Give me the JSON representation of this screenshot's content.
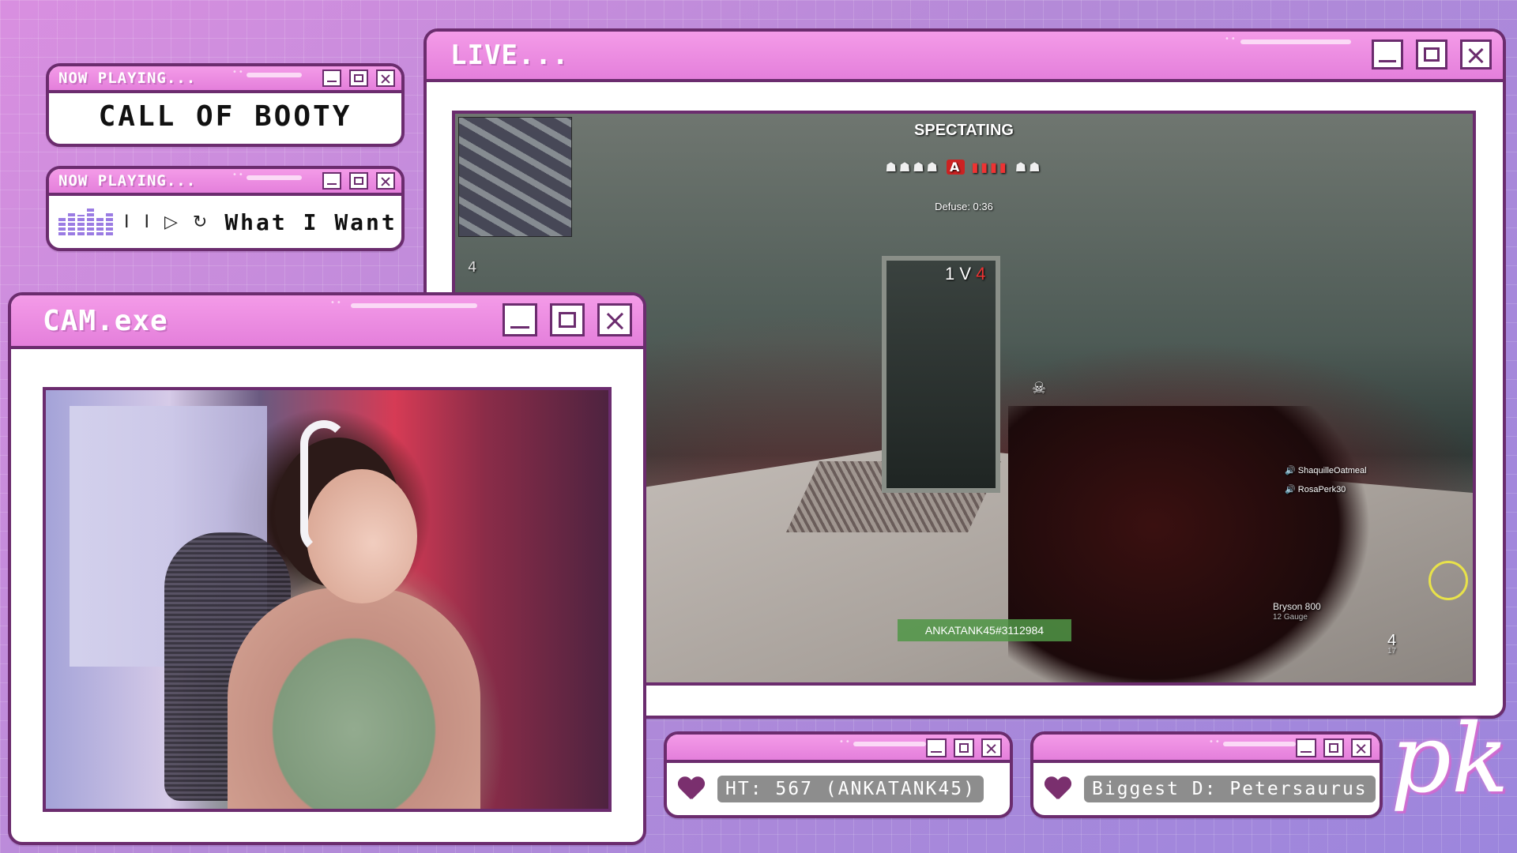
{
  "now_playing_game": {
    "title": "NOW PLAYING...",
    "name": "CALL OF BOOTY"
  },
  "now_playing_music": {
    "title": "NOW PLAYING...",
    "controls": "I I ▷ ↻",
    "song": "What I Want"
  },
  "live_window": {
    "title": "LIVE...",
    "game_hud": {
      "spectating": "SPECTATING",
      "objective": "A",
      "defuse_timer": "Defuse: 0:36",
      "versus_left": "1",
      "versus_mid": "V",
      "versus_right": "4",
      "round_number": "4",
      "voice_players": [
        "ShaquilleOatmeal",
        "RosaPerk30"
      ],
      "spectated_player": "ANKATANK45#3112984",
      "weapon_name": "Bryson 800",
      "weapon_type": "12 Gauge",
      "ammo": "4",
      "ammo_reserve": "17"
    }
  },
  "cam_window": {
    "title": "CAM.exe"
  },
  "high_tip": {
    "text": "HT: 567 (ANKATANK45)"
  },
  "biggest_donation": {
    "text": "Biggest D: Petersaurus"
  },
  "logo": {
    "text": "pk"
  },
  "colors": {
    "window_border": "#6b2c6e",
    "titlebar": "#e47fdb",
    "background": "#b58ad6",
    "pill": "#8d8d8d"
  },
  "icons": [
    "minimize-icon",
    "maximize-icon",
    "close-icon",
    "heart-icon",
    "equalizer-icon",
    "skull-icon"
  ]
}
